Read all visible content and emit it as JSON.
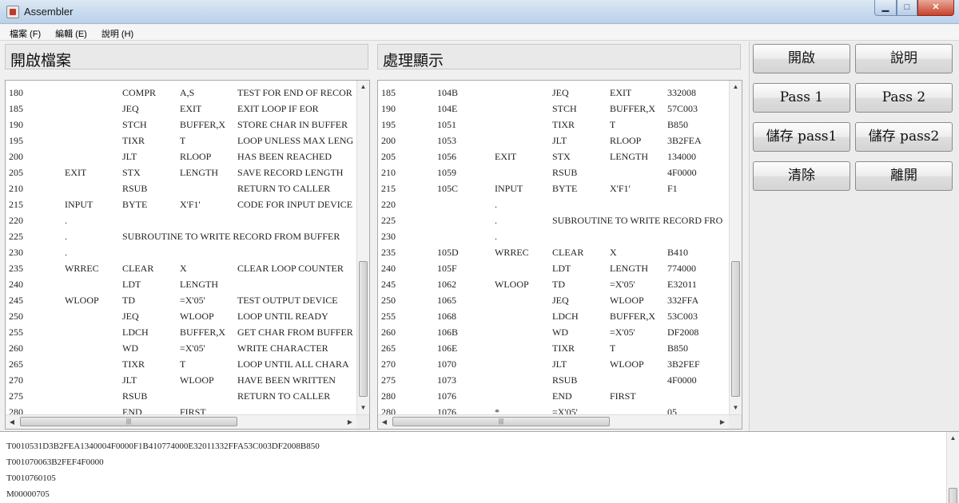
{
  "window": {
    "title": "Assembler",
    "min_label": "▁",
    "max_label": "□",
    "close_label": "✕"
  },
  "menu": [
    {
      "label": "檔案 (F)"
    },
    {
      "label": "編輯 (E)"
    },
    {
      "label": "說明 (H)"
    }
  ],
  "left_panel": {
    "header": "開啟檔案",
    "rows": [
      [
        "180",
        "",
        "COMPR",
        "A,S",
        "TEST FOR END OF RECOR"
      ],
      [
        "185",
        "",
        "JEQ",
        "EXIT",
        "EXIT LOOP IF EOR"
      ],
      [
        "190",
        "",
        "STCH",
        "BUFFER,X",
        "STORE CHAR IN BUFFER"
      ],
      [
        "195",
        "",
        "TIXR",
        "T",
        "LOOP UNLESS MAX LENG"
      ],
      [
        "200",
        "",
        "JLT",
        "RLOOP",
        "HAS BEEN REACHED"
      ],
      [
        "205",
        "EXIT",
        "STX",
        "LENGTH",
        "SAVE RECORD LENGTH"
      ],
      [
        "210",
        "",
        "RSUB",
        "",
        "RETURN TO CALLER"
      ],
      [
        "215",
        "INPUT",
        "BYTE",
        "X'F1'",
        "CODE FOR INPUT DEVICE"
      ],
      [
        "220",
        ".",
        "",
        "",
        ""
      ],
      [
        "225",
        ".",
        "SUBROUTINE TO WRITE RECORD FROM BUFFER",
        "",
        ""
      ],
      [
        "230",
        ".",
        "",
        "",
        ""
      ],
      [
        "235",
        "WRREC",
        "CLEAR",
        "X",
        "CLEAR LOOP COUNTER"
      ],
      [
        "240",
        "",
        "LDT",
        "LENGTH",
        ""
      ],
      [
        "245",
        "WLOOP",
        "TD",
        "=X'05'",
        "TEST OUTPUT DEVICE"
      ],
      [
        "250",
        "",
        "JEQ",
        "WLOOP",
        "LOOP UNTIL READY"
      ],
      [
        "255",
        "",
        "LDCH",
        "BUFFER,X",
        "GET CHAR FROM BUFFER"
      ],
      [
        "260",
        "",
        "WD",
        "=X'05'",
        "WRITE CHARACTER"
      ],
      [
        "265",
        "",
        "TIXR",
        "T",
        "LOOP UNTIL ALL CHARA"
      ],
      [
        "270",
        "",
        "JLT",
        "WLOOP",
        "HAVE BEEN WRITTEN"
      ],
      [
        "275",
        "",
        "RSUB",
        "",
        "RETURN TO CALLER"
      ],
      [
        "280",
        "",
        "END",
        "FIRST",
        ""
      ]
    ]
  },
  "right_panel": {
    "header": "處理顯示",
    "rows": [
      [
        "185",
        "104B",
        "",
        "JEQ",
        "EXIT",
        "332008"
      ],
      [
        "190",
        "104E",
        "",
        "STCH",
        "BUFFER,X",
        "57C003"
      ],
      [
        "195",
        "1051",
        "",
        "TIXR",
        "T",
        "B850"
      ],
      [
        "200",
        "1053",
        "",
        "JLT",
        "RLOOP",
        "3B2FEA"
      ],
      [
        "205",
        "1056",
        "EXIT",
        "STX",
        "LENGTH",
        "134000"
      ],
      [
        "210",
        "1059",
        "",
        "RSUB",
        "",
        "4F0000"
      ],
      [
        "215",
        "105C",
        "INPUT",
        "BYTE",
        "X'F1'",
        "F1"
      ],
      [
        "220",
        "",
        ".",
        "",
        "",
        ""
      ],
      [
        "225",
        "",
        ".",
        "SUBROUTINE TO WRITE RECORD FRO",
        "",
        ""
      ],
      [
        "230",
        "",
        ".",
        "",
        "",
        ""
      ],
      [
        "235",
        "105D",
        "WRREC",
        "CLEAR",
        "X",
        "B410"
      ],
      [
        "240",
        "105F",
        "",
        "LDT",
        "LENGTH",
        "774000"
      ],
      [
        "245",
        "1062",
        "WLOOP",
        "TD",
        "=X'05'",
        "E32011"
      ],
      [
        "250",
        "1065",
        "",
        "JEQ",
        "WLOOP",
        "332FFA"
      ],
      [
        "255",
        "1068",
        "",
        "LDCH",
        "BUFFER,X",
        "53C003"
      ],
      [
        "260",
        "106B",
        "",
        "WD",
        "=X'05'",
        "DF2008"
      ],
      [
        "265",
        "106E",
        "",
        "TIXR",
        "T",
        "B850"
      ],
      [
        "270",
        "1070",
        "",
        "JLT",
        "WLOOP",
        "3B2FEF"
      ],
      [
        "275",
        "1073",
        "",
        "RSUB",
        "",
        "4F0000"
      ],
      [
        "280",
        "1076",
        "",
        "END",
        "FIRST",
        ""
      ],
      [
        "280",
        "1076",
        "*",
        "=X'05'",
        "",
        "05"
      ]
    ]
  },
  "buttons": {
    "open": "開啟",
    "help": "說明",
    "pass1": "Pass 1",
    "pass2": "Pass 2",
    "save_pass1": "儲存 pass1",
    "save_pass2": "儲存 pass2",
    "clear": "清除",
    "exit": "離開"
  },
  "scroll": {
    "grip": "≡",
    "hgrip": "|||"
  },
  "output": [
    "T0010531D3B2FEA1340004F0000F1B410774000E32011332FFA53C003DF2008B850",
    "T001070063B2FEF4F0000",
    "T0010760105",
    "M00000705"
  ]
}
